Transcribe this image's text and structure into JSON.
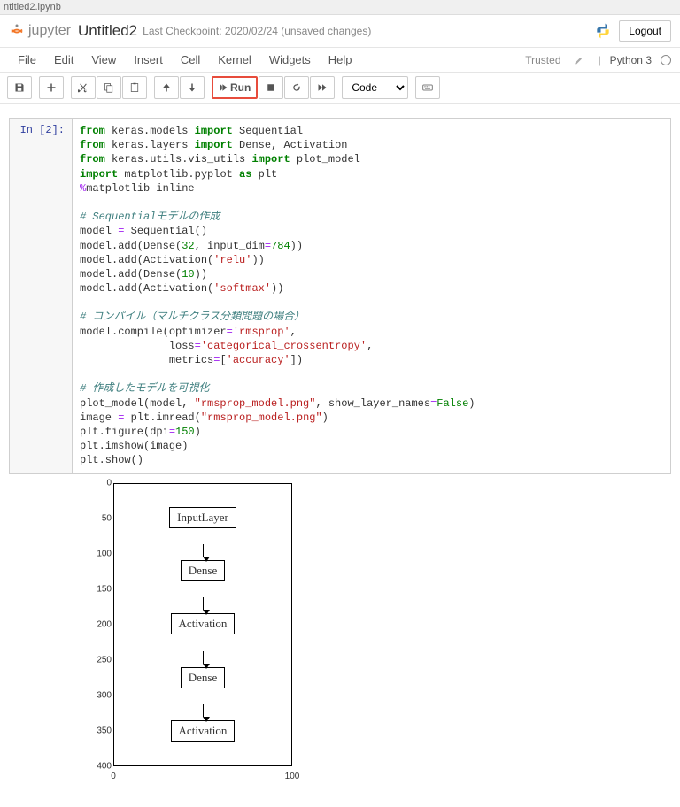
{
  "tab": "ntitled2.ipynb",
  "header": {
    "logo_text": "jupyter",
    "title": "Untitled2",
    "checkpoint": "Last Checkpoint: 2020/02/24  (unsaved changes)",
    "logout": "Logout"
  },
  "menu": {
    "file": "File",
    "edit": "Edit",
    "view": "View",
    "insert": "Insert",
    "cell": "Cell",
    "kernel": "Kernel",
    "widgets": "Widgets",
    "help": "Help",
    "trusted": "Trusted",
    "kernel_name": "Python 3"
  },
  "toolbar": {
    "run_label": "Run",
    "cell_type": "Code"
  },
  "cell": {
    "prompt": "In [2]:",
    "code": {
      "l1a": "from",
      "l1b": " keras.models ",
      "l1c": "import",
      "l1d": " Sequential",
      "l2a": "from",
      "l2b": " keras.layers ",
      "l2c": "import",
      "l2d": " Dense, Activation",
      "l3a": "from",
      "l3b": " keras.utils.vis_utils ",
      "l3c": "import",
      "l3d": " plot_model",
      "l4a": "import",
      "l4b": " matplotlib.pyplot ",
      "l4c": "as",
      "l4d": " plt",
      "l5a": "%",
      "l5b": "matplotlib inline",
      "c1": "# Sequentialモデルの作成",
      "l6a": "model ",
      "l6b": "=",
      "l6c": " Sequential()",
      "l7a": "model.add(Dense(",
      "l7b": "32",
      "l7c": ", input_dim",
      "l7d": "=",
      "l7e": "784",
      "l7f": "))",
      "l8a": "model.add(Activation(",
      "l8b": "'relu'",
      "l8c": "))",
      "l9a": "model.add(Dense(",
      "l9b": "10",
      "l9c": "))",
      "l10a": "model.add(Activation(",
      "l10b": "'softmax'",
      "l10c": "))",
      "c2": "# コンパイル（マルチクラス分類問題の場合）",
      "l11a": "model.compile(optimizer",
      "l11b": "=",
      "l11c": "'rmsprop'",
      "l11d": ",",
      "l12a": "              loss",
      "l12b": "=",
      "l12c": "'categorical_crossentropy'",
      "l12d": ",",
      "l13a": "              metrics",
      "l13b": "=",
      "l13c": "[",
      "l13d": "'accuracy'",
      "l13e": "])",
      "c3": "# 作成したモデルを可視化",
      "l14a": "plot_model(model, ",
      "l14b": "\"rmsprop_model.png\"",
      "l14c": ", show_layer_names",
      "l14d": "=",
      "l14e": "False",
      "l14f": ")",
      "l15a": "image ",
      "l15b": "=",
      "l15c": " plt.imread(",
      "l15d": "\"rmsprop_model.png\"",
      "l15e": ")",
      "l16a": "plt.figure(dpi",
      "l16b": "=",
      "l16c": "150",
      "l16d": ")",
      "l17": "plt.imshow(image)",
      "l18": "plt.show()"
    }
  },
  "chart_data": {
    "type": "diagram",
    "title": "",
    "xlabel": "",
    "ylabel": "",
    "xlim": [
      0,
      100
    ],
    "ylim": [
      0,
      420
    ],
    "y_ticks": [
      0,
      50,
      100,
      150,
      200,
      250,
      300,
      350,
      400
    ],
    "x_ticks": [
      0,
      100
    ],
    "nodes": [
      "InputLayer",
      "Dense",
      "Activation",
      "Dense",
      "Activation"
    ]
  }
}
